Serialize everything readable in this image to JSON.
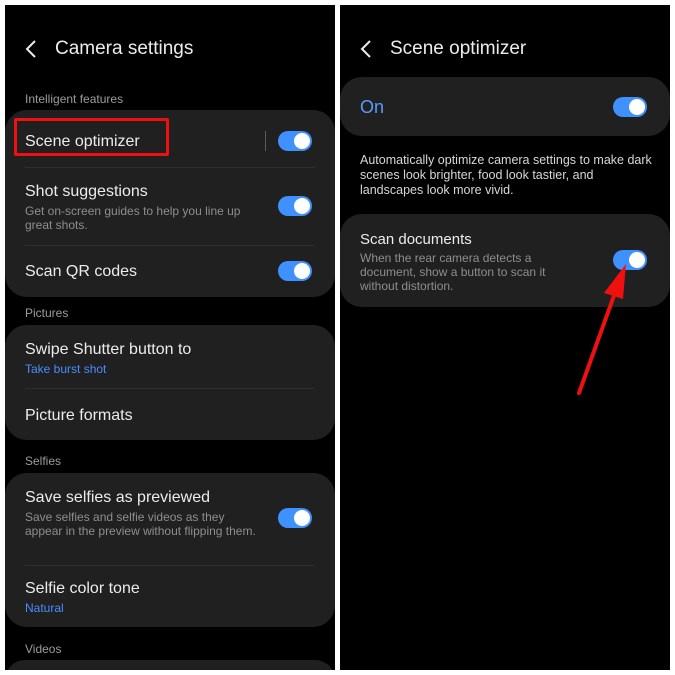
{
  "left": {
    "header": {
      "title": "Camera settings"
    },
    "sections": {
      "intelligent": "Intelligent features",
      "pictures": "Pictures",
      "selfies": "Selfies",
      "videos": "Videos"
    },
    "items": {
      "scene_optimizer": {
        "title": "Scene optimizer",
        "toggle": true
      },
      "shot_suggestions": {
        "title": "Shot suggestions",
        "subtitle": "Get on-screen guides to help you line up great shots.",
        "toggle": true
      },
      "scan_qr": {
        "title": "Scan QR codes",
        "toggle": true
      },
      "swipe_shutter": {
        "title": "Swipe Shutter button to",
        "value": "Take burst shot"
      },
      "picture_formats": {
        "title": "Picture formats"
      },
      "save_selfies": {
        "title": "Save selfies as previewed",
        "subtitle": "Save selfies and selfie videos as they appear in the preview without flipping them.",
        "toggle": true
      },
      "selfie_tone": {
        "title": "Selfie color tone",
        "value": "Natural"
      }
    }
  },
  "right": {
    "header": {
      "title": "Scene optimizer"
    },
    "master": {
      "label": "On",
      "toggle": true
    },
    "description": "Automatically optimize camera settings to make dark scenes look brighter, food look tastier, and landscapes look more vivid.",
    "scan_documents": {
      "title": "Scan documents",
      "subtitle": "When the rear camera detects a document, show a button to scan it without distortion.",
      "toggle": true
    }
  },
  "colors": {
    "accent": "#3e91ff",
    "link": "#4a8dff",
    "highlight": "#f01010",
    "card": "#202020",
    "background": "#000000"
  },
  "icons": {
    "back": "chevron-left-icon",
    "arrow": "red-arrow-annotation"
  }
}
